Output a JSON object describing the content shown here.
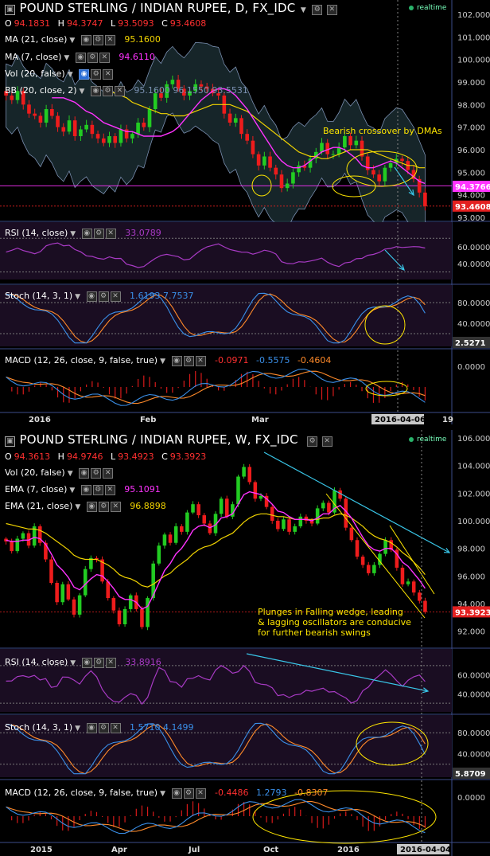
{
  "colors": {
    "up": "#22cc22",
    "down": "#ee1c1c",
    "ma_short": "#ff33ff",
    "ma_long": "#f2d400",
    "bb": "#7a8fb0",
    "rsi": "#a83ac4",
    "stoch_k": "#3a8fe8",
    "stoch_d": "#ff8a2a",
    "macd": "#3a8fe8",
    "signal": "#ff8a2a",
    "hist": "#d81a1a",
    "cyan": "#39c6e8",
    "yellow": "#ffe600",
    "price_tag": "#e32020",
    "ma_tag": "#ff33ff"
  },
  "daily": {
    "title": "POUND STERLING / INDIAN RUPEE, D, FX_IDC",
    "realtime": "realtime",
    "ohlc": [
      {
        "k": "O",
        "v": "94.1831"
      },
      {
        "k": "H",
        "v": "94.3747"
      },
      {
        "k": "L",
        "v": "93.5093"
      },
      {
        "k": "C",
        "v": "93.4608"
      }
    ],
    "indicators": [
      {
        "label": "MA (21, close)",
        "value": "95.1600",
        "color": "#f2d400"
      },
      {
        "label": "MA (7, close)",
        "value": "94.6110",
        "color": "#ff33ff"
      },
      {
        "label": "Vol (20, false)",
        "value": "",
        "color": "#888"
      },
      {
        "label": "BB (20, close, 2)",
        "value": "95.1600 96.1550 93.5531",
        "color": "#7a8fb0"
      }
    ],
    "y_ticks": [
      "102.000",
      "101.000",
      "100.000",
      "99.000",
      "98.000",
      "97.000",
      "96.000",
      "95.000",
      "94.000",
      "93.000"
    ],
    "price_tag": "93.4608",
    "ma_tag": "94.3766",
    "annotation": "Bearish crossover by DMAs",
    "rsi": {
      "label": "RSI (14, close)",
      "value": "33.0789",
      "ticks": [
        "60.0000",
        "40.0000"
      ]
    },
    "stoch": {
      "label": "Stoch (14, 3, 1)",
      "value": "1.6193 7.7537",
      "ticks": [
        "80.0000",
        "40.0000"
      ],
      "tag": "2.5271"
    },
    "macd": {
      "label": "MACD (12, 26, close, 9, false, true)",
      "values": [
        "-0.0971",
        "-0.5575",
        "-0.4604"
      ],
      "ticks": [
        "0.0000"
      ]
    },
    "x_labels": [
      "2016",
      "Feb",
      "Mar",
      "2016-04-06",
      "19"
    ]
  },
  "weekly": {
    "title": "POUND STERLING / INDIAN RUPEE, W, FX_IDC",
    "realtime": "realtime",
    "ohlc": [
      {
        "k": "O",
        "v": "94.3613"
      },
      {
        "k": "H",
        "v": "94.9746"
      },
      {
        "k": "L",
        "v": "93.4923"
      },
      {
        "k": "C",
        "v": "93.3923"
      }
    ],
    "indicators": [
      {
        "label": "Vol (20, false)",
        "value": "",
        "color": "#888"
      },
      {
        "label": "EMA (7, close)",
        "value": "95.1091",
        "color": "#ff33ff"
      },
      {
        "label": "EMA (21, close)",
        "value": "96.8898",
        "color": "#f2d400"
      }
    ],
    "y_ticks": [
      "106.000",
      "104.000",
      "102.000",
      "100.000",
      "98.000",
      "96.000",
      "94.000",
      "92.000"
    ],
    "price_tag": "93.3923",
    "annotation": [
      "Plunges in Falling wedge, leading",
      "& lagging oscillators are conducive",
      "for further bearish swings"
    ],
    "rsi": {
      "label": "RSI (14, close)",
      "value": "33.8916",
      "ticks": [
        "60.0000",
        "40.0000"
      ]
    },
    "stoch": {
      "label": "Stoch (14, 3, 1)",
      "value": "1.5710 4.1499",
      "ticks": [
        "80.0000",
        "40.0000"
      ],
      "tag": "5.8709"
    },
    "macd": {
      "label": "MACD (12, 26, close, 9, false, true)",
      "values": [
        "-0.4486",
        "1.2793",
        "-0.8307"
      ],
      "ticks": [
        "0.0000"
      ]
    },
    "x_labels": [
      "2015",
      "Apr",
      "Jul",
      "Oct",
      "2016",
      "2016-04-04"
    ]
  },
  "chart_data": [
    {
      "type": "candlestick",
      "title": "POUND STERLING / INDIAN RUPEE, D, FX_IDC",
      "x_labels": [
        "2016",
        "Feb",
        "Mar",
        "2016-04-06",
        "19"
      ],
      "ylim": [
        93,
        102
      ],
      "close": [
        98.4,
        98.2,
        98.6,
        98.0,
        97.6,
        97.5,
        97.2,
        97.8,
        97.5,
        97.0,
        96.8,
        97.3,
        96.6,
        96.9,
        97.1,
        96.7,
        96.5,
        96.3,
        96.6,
        96.3,
        96.9,
        96.5,
        96.7,
        97.2,
        97.0,
        97.8,
        98.5,
        98.3,
        98.9,
        99.1,
        98.7,
        98.4,
        98.6,
        98.9,
        98.8,
        98.7,
        98.5,
        98.4,
        97.6,
        97.2,
        97.4,
        96.7,
        96.4,
        95.8,
        95.3,
        95.7,
        95.2,
        94.9,
        94.3,
        94.5,
        95.0,
        95.3,
        95.2,
        95.6,
        95.9,
        96.3,
        95.8,
        95.8,
        96.1,
        96.6,
        96.2,
        96.4,
        95.7,
        95.1,
        94.9,
        94.6,
        95.2,
        95.4,
        95.6,
        95.5,
        95.1,
        94.7,
        94.1,
        93.5
      ],
      "ma_7": [
        98.3,
        98.3,
        98.3,
        98.2,
        98.1,
        97.9,
        97.7,
        97.6,
        97.4,
        97.2,
        97.1,
        97.0,
        96.9,
        96.8,
        96.8,
        96.7,
        96.6,
        96.6,
        96.6,
        96.6,
        96.7,
        96.8,
        97.0,
        97.3,
        97.6,
        97.9,
        98.2,
        98.4,
        98.6,
        98.7,
        98.7,
        98.6,
        98.4,
        98.1,
        97.8,
        97.4,
        97.0,
        96.6,
        96.2,
        95.8,
        95.5,
        95.3,
        95.2,
        95.2,
        95.3,
        95.5,
        95.7,
        95.9,
        96.0,
        96.1,
        96.1,
        96.0,
        95.8,
        95.6,
        95.3,
        95.2,
        95.2,
        95.3,
        95.4,
        95.5,
        95.4,
        95.2,
        95.0,
        94.8,
        94.6,
        94.5
      ],
      "ma_21": [
        98.7,
        98.6,
        98.5,
        98.4,
        98.3,
        98.1,
        98.0,
        97.9,
        97.8,
        97.7,
        97.6,
        97.6,
        97.5,
        97.5,
        97.5,
        97.6,
        97.7,
        97.8,
        97.9,
        98.0,
        98.0,
        98.0,
        98.0,
        97.9,
        97.8,
        97.7,
        97.5,
        97.3,
        97.1,
        96.9,
        96.7,
        96.5,
        96.3,
        96.1,
        95.9,
        95.8,
        95.7,
        95.7,
        95.6,
        95.6,
        95.7,
        95.8,
        95.9,
        96.0,
        96.0,
        96.0,
        96.0,
        95.9,
        95.8,
        95.7,
        95.6,
        95.5,
        95.4,
        95.3,
        95.3,
        95.2,
        95.2
      ],
      "rsi_range": [
        20,
        75
      ],
      "stoch_range": [
        0,
        100
      ],
      "macd_range": [
        -1.5,
        1.5
      ]
    },
    {
      "type": "candlestick",
      "title": "POUND STERLING / INDIAN RUPEE, W, FX_IDC",
      "x_labels": [
        "2015",
        "Apr",
        "Jul",
        "Oct",
        "2016",
        "2016-04-04"
      ],
      "ylim": [
        91,
        106
      ],
      "close": [
        98.5,
        97.8,
        98.7,
        99.1,
        98.2,
        99.6,
        98.4,
        97.2,
        95.5,
        94.1,
        95.4,
        94.3,
        93.2,
        94.6,
        96.5,
        97.3,
        97.2,
        95.6,
        94.4,
        93.5,
        92.5,
        93.6,
        94.6,
        93.6,
        92.3,
        94.4,
        96.9,
        98.2,
        99.0,
        98.4,
        99.6,
        99.2,
        100.6,
        101.2,
        100.4,
        99.8,
        99.1,
        100.5,
        101.6,
        100.3,
        101.2,
        103.2,
        103.9,
        102.8,
        101.6,
        101.8,
        101.0,
        100.0,
        99.4,
        100.1,
        99.2,
        99.6,
        100.3,
        100.0,
        99.8,
        100.9,
        101.3,
        100.6,
        102.2,
        101.6,
        99.5,
        98.6,
        97.4,
        96.8,
        96.2,
        96.8,
        97.6,
        98.6,
        97.9,
        96.6,
        95.4,
        95.6,
        94.8,
        94.2,
        93.4
      ],
      "ema_7": [
        98.6,
        98.5,
        98.5,
        98.6,
        98.6,
        98.8,
        98.7,
        98.3,
        97.6,
        96.8,
        96.4,
        95.9,
        95.2,
        95.0,
        95.4,
        95.8,
        96.1,
        96.0,
        95.6,
        95.1,
        94.5,
        94.3,
        94.3,
        94.1,
        93.6,
        93.8,
        94.6,
        95.5,
        96.4,
        96.9,
        97.6,
        98.0,
        98.6,
        99.3,
        99.6,
        99.7,
        99.5,
        99.7,
        100.2,
        100.3,
        100.5,
        101.2,
        101.9,
        102.1,
        102.0,
        101.9,
        101.6,
        101.2,
        100.7,
        100.6,
        100.3,
        100.1,
        100.1,
        100.1,
        100.0,
        100.2,
        100.5,
        100.5,
        100.9,
        101.1,
        100.7,
        100.2,
        99.5,
        98.8,
        98.2,
        97.9,
        97.8,
        98.0,
        98.0,
        97.6,
        97.0,
        96.7,
        96.2,
        95.7,
        95.1
      ],
      "ema_21": [
        99.8,
        99.7,
        99.6,
        99.5,
        99.4,
        99.4,
        99.3,
        99.1,
        98.8,
        98.5,
        98.2,
        97.9,
        97.5,
        97.3,
        97.2,
        97.2,
        97.2,
        97.0,
        96.8,
        96.5,
        96.1,
        95.9,
        95.8,
        95.6,
        95.3,
        95.2,
        95.4,
        95.7,
        96.0,
        96.2,
        96.6,
        96.9,
        97.2,
        97.6,
        97.9,
        98.1,
        98.2,
        98.4,
        98.7,
        98.9,
        99.1,
        99.5,
        99.9,
        100.2,
        100.4,
        100.5,
        100.5,
        100.4,
        100.3,
        100.3,
        100.2,
        100.1,
        100.1,
        100.1,
        100.1,
        100.1,
        100.2,
        100.2,
        100.4,
        100.5,
        100.4,
        100.2,
        99.9,
        99.6,
        99.2,
        98.9,
        98.7,
        98.6,
        98.4,
        98.1,
        97.7,
        97.4,
        97.0,
        96.6,
        96.1
      ],
      "rsi_range": [
        20,
        75
      ],
      "stoch_range": [
        0,
        100
      ],
      "macd_range": [
        -2.5,
        2.5
      ]
    }
  ]
}
